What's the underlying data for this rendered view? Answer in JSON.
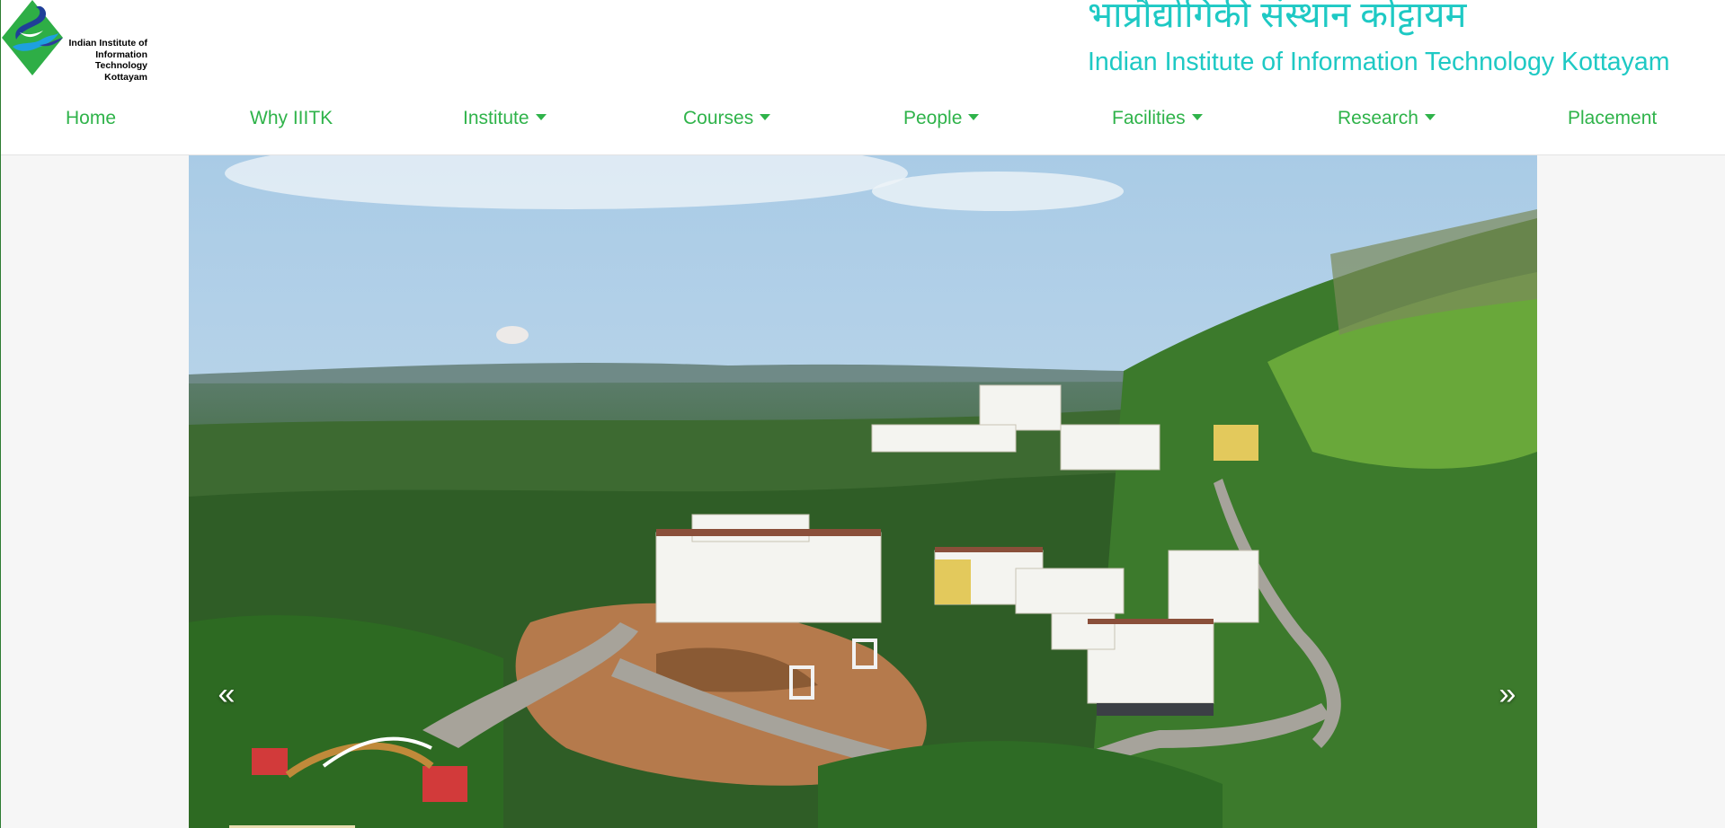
{
  "logo": {
    "lines": [
      "Indian Institute of",
      "Information Technology",
      "Kottayam"
    ]
  },
  "header": {
    "title_hindi": "भाप्रौद्योगिकी संस्थान कोट्टायम",
    "title_english": "Indian Institute of Information Technology Kottayam"
  },
  "nav": {
    "items": [
      {
        "label": "Home",
        "dropdown": false
      },
      {
        "label": "Why IIITK",
        "dropdown": false
      },
      {
        "label": "Institute",
        "dropdown": true
      },
      {
        "label": "Courses",
        "dropdown": true
      },
      {
        "label": "People",
        "dropdown": true
      },
      {
        "label": "Facilities",
        "dropdown": true
      },
      {
        "label": "Research",
        "dropdown": true
      },
      {
        "label": "Placement",
        "dropdown": false
      }
    ]
  },
  "carousel": {
    "prev_label": "«",
    "next_label": "»"
  },
  "colors": {
    "brand_teal": "#1ec9c4",
    "nav_green": "#2fb34a"
  },
  "icons": {
    "caret": "caret-down-icon",
    "prev": "chevron-double-left-icon",
    "next": "chevron-double-right-icon"
  }
}
